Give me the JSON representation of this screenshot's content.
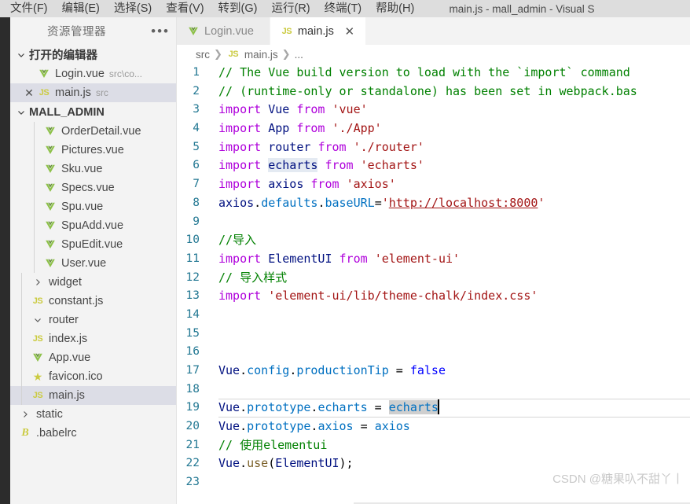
{
  "window": {
    "title": "main.js - mall_admin - Visual S",
    "menu": [
      {
        "label": "文件(F)",
        "name": "menu-file"
      },
      {
        "label": "编辑(E)",
        "name": "menu-edit"
      },
      {
        "label": "选择(S)",
        "name": "menu-selection"
      },
      {
        "label": "查看(V)",
        "name": "menu-view"
      },
      {
        "label": "转到(G)",
        "name": "menu-go"
      },
      {
        "label": "运行(R)",
        "name": "menu-run"
      },
      {
        "label": "终端(T)",
        "name": "menu-terminal"
      },
      {
        "label": "帮助(H)",
        "name": "menu-help"
      }
    ]
  },
  "sidebar": {
    "header": "资源管理器",
    "more_icon": "•••",
    "open_editors": {
      "title": "打开的编辑器",
      "items": [
        {
          "label": "Login.vue",
          "desc": "src\\co...",
          "icon": "vue",
          "close": false,
          "selected": false
        },
        {
          "label": "main.js",
          "desc": "src",
          "icon": "js",
          "close": true,
          "selected": true
        }
      ]
    },
    "project": {
      "title": "MALL_ADMIN",
      "items": [
        {
          "label": "OrderDetail.vue",
          "icon": "vue",
          "indent": 3,
          "kind": "file"
        },
        {
          "label": "Pictures.vue",
          "icon": "vue",
          "indent": 3,
          "kind": "file"
        },
        {
          "label": "Sku.vue",
          "icon": "vue",
          "indent": 3,
          "kind": "file"
        },
        {
          "label": "Specs.vue",
          "icon": "vue",
          "indent": 3,
          "kind": "file"
        },
        {
          "label": "Spu.vue",
          "icon": "vue",
          "indent": 3,
          "kind": "file"
        },
        {
          "label": "SpuAdd.vue",
          "icon": "vue",
          "indent": 3,
          "kind": "file"
        },
        {
          "label": "SpuEdit.vue",
          "icon": "vue",
          "indent": 3,
          "kind": "file"
        },
        {
          "label": "User.vue",
          "icon": "vue",
          "indent": 3,
          "kind": "file"
        },
        {
          "label": "widget",
          "icon": "chevron-right",
          "indent": 2,
          "kind": "folder-collapsed"
        },
        {
          "label": "constant.js",
          "icon": "js",
          "indent": 2,
          "kind": "file"
        },
        {
          "label": "router",
          "icon": "chevron-down",
          "indent": 2,
          "kind": "folder-expanded"
        },
        {
          "label": "index.js",
          "icon": "js",
          "indent": 2,
          "kind": "file"
        },
        {
          "label": "App.vue",
          "icon": "vue",
          "indent": 2,
          "kind": "file"
        },
        {
          "label": "favicon.ico",
          "icon": "star",
          "indent": 2,
          "kind": "file"
        },
        {
          "label": "main.js",
          "icon": "js",
          "indent": 2,
          "kind": "file",
          "selected": true
        },
        {
          "label": "static",
          "icon": "chevron-right",
          "indent": 1,
          "kind": "folder-collapsed"
        },
        {
          "label": ".babelrc",
          "icon": "babel",
          "indent": 1,
          "kind": "file"
        }
      ]
    }
  },
  "editor": {
    "tabs": [
      {
        "label": "Login.vue",
        "icon": "vue",
        "active": false,
        "closable": false
      },
      {
        "label": "main.js",
        "icon": "js",
        "active": true,
        "closable": true
      }
    ],
    "breadcrumb": [
      {
        "label": "src",
        "icon": null
      },
      {
        "label": "main.js",
        "icon": "js"
      },
      {
        "label": "...",
        "icon": null
      }
    ],
    "current_line": 19,
    "lines": [
      {
        "n": 1,
        "tokens": [
          {
            "t": "// The Vue build version to load with the `import` command",
            "c": "t-comment"
          }
        ]
      },
      {
        "n": 2,
        "tokens": [
          {
            "t": "// (runtime-only or standalone) has been set in webpack.bas",
            "c": "t-comment"
          }
        ]
      },
      {
        "n": 3,
        "tokens": [
          {
            "t": "import",
            "c": "t-keyword"
          },
          {
            "t": " ",
            "c": "t-plain"
          },
          {
            "t": "Vue",
            "c": "t-var"
          },
          {
            "t": " ",
            "c": "t-plain"
          },
          {
            "t": "from",
            "c": "t-keyword"
          },
          {
            "t": " ",
            "c": "t-plain"
          },
          {
            "t": "'vue'",
            "c": "t-string"
          }
        ]
      },
      {
        "n": 4,
        "tokens": [
          {
            "t": "import",
            "c": "t-keyword"
          },
          {
            "t": " ",
            "c": "t-plain"
          },
          {
            "t": "App",
            "c": "t-var"
          },
          {
            "t": " ",
            "c": "t-plain"
          },
          {
            "t": "from",
            "c": "t-keyword"
          },
          {
            "t": " ",
            "c": "t-plain"
          },
          {
            "t": "'./App'",
            "c": "t-string"
          }
        ]
      },
      {
        "n": 5,
        "tokens": [
          {
            "t": "import",
            "c": "t-keyword"
          },
          {
            "t": " ",
            "c": "t-plain"
          },
          {
            "t": "router",
            "c": "t-var"
          },
          {
            "t": " ",
            "c": "t-plain"
          },
          {
            "t": "from",
            "c": "t-keyword"
          },
          {
            "t": " ",
            "c": "t-plain"
          },
          {
            "t": "'./router'",
            "c": "t-string"
          }
        ]
      },
      {
        "n": 6,
        "tokens": [
          {
            "t": "import",
            "c": "t-keyword"
          },
          {
            "t": " ",
            "c": "t-plain"
          },
          {
            "t": "echarts",
            "c": "t-var",
            "hl": "match"
          },
          {
            "t": " ",
            "c": "t-plain"
          },
          {
            "t": "from",
            "c": "t-keyword"
          },
          {
            "t": " ",
            "c": "t-plain"
          },
          {
            "t": "'echarts'",
            "c": "t-string"
          }
        ]
      },
      {
        "n": 7,
        "tokens": [
          {
            "t": "import",
            "c": "t-keyword"
          },
          {
            "t": " ",
            "c": "t-plain"
          },
          {
            "t": "axios",
            "c": "t-var"
          },
          {
            "t": " ",
            "c": "t-plain"
          },
          {
            "t": "from",
            "c": "t-keyword"
          },
          {
            "t": " ",
            "c": "t-plain"
          },
          {
            "t": "'axios'",
            "c": "t-string"
          }
        ]
      },
      {
        "n": 8,
        "tokens": [
          {
            "t": "axios",
            "c": "t-var"
          },
          {
            "t": ".",
            "c": "t-punct"
          },
          {
            "t": "defaults",
            "c": "t-prop"
          },
          {
            "t": ".",
            "c": "t-punct"
          },
          {
            "t": "baseURL",
            "c": "t-prop"
          },
          {
            "t": "=",
            "c": "t-punct"
          },
          {
            "t": "'",
            "c": "t-string"
          },
          {
            "t": "http://localhost:8000",
            "c": "t-link"
          },
          {
            "t": "'",
            "c": "t-string"
          }
        ]
      },
      {
        "n": 9,
        "tokens": []
      },
      {
        "n": 10,
        "tokens": [
          {
            "t": "//导入",
            "c": "t-comment"
          }
        ]
      },
      {
        "n": 11,
        "tokens": [
          {
            "t": "import",
            "c": "t-keyword"
          },
          {
            "t": " ",
            "c": "t-plain"
          },
          {
            "t": "ElementUI",
            "c": "t-var"
          },
          {
            "t": " ",
            "c": "t-plain"
          },
          {
            "t": "from",
            "c": "t-keyword"
          },
          {
            "t": " ",
            "c": "t-plain"
          },
          {
            "t": "'element-ui'",
            "c": "t-string"
          }
        ]
      },
      {
        "n": 12,
        "tokens": [
          {
            "t": "// 导入样式",
            "c": "t-comment"
          }
        ]
      },
      {
        "n": 13,
        "tokens": [
          {
            "t": "import",
            "c": "t-keyword"
          },
          {
            "t": " ",
            "c": "t-plain"
          },
          {
            "t": "'element-ui/lib/theme-chalk/index.css'",
            "c": "t-string"
          }
        ]
      },
      {
        "n": 14,
        "tokens": []
      },
      {
        "n": 15,
        "tokens": []
      },
      {
        "n": 16,
        "tokens": []
      },
      {
        "n": 17,
        "tokens": [
          {
            "t": "Vue",
            "c": "t-var"
          },
          {
            "t": ".",
            "c": "t-punct"
          },
          {
            "t": "config",
            "c": "t-prop"
          },
          {
            "t": ".",
            "c": "t-punct"
          },
          {
            "t": "productionTip",
            "c": "t-prop"
          },
          {
            "t": " = ",
            "c": "t-punct"
          },
          {
            "t": "false",
            "c": "t-const"
          }
        ]
      },
      {
        "n": 18,
        "tokens": []
      },
      {
        "n": 19,
        "tokens": [
          {
            "t": "Vue",
            "c": "t-var"
          },
          {
            "t": ".",
            "c": "t-punct"
          },
          {
            "t": "prototype",
            "c": "t-prop"
          },
          {
            "t": ".",
            "c": "t-punct"
          },
          {
            "t": "echarts",
            "c": "t-prop"
          },
          {
            "t": " = ",
            "c": "t-punct"
          },
          {
            "t": "echarts",
            "c": "t-prop",
            "hl": "active"
          }
        ],
        "caret": true
      },
      {
        "n": 20,
        "tokens": [
          {
            "t": "Vue",
            "c": "t-var"
          },
          {
            "t": ".",
            "c": "t-punct"
          },
          {
            "t": "prototype",
            "c": "t-prop"
          },
          {
            "t": ".",
            "c": "t-punct"
          },
          {
            "t": "axios",
            "c": "t-prop"
          },
          {
            "t": " = ",
            "c": "t-punct"
          },
          {
            "t": "axios",
            "c": "t-prop"
          }
        ]
      },
      {
        "n": 21,
        "tokens": [
          {
            "t": "// 使用elementui",
            "c": "t-comment"
          }
        ]
      },
      {
        "n": 22,
        "tokens": [
          {
            "t": "Vue",
            "c": "t-var"
          },
          {
            "t": ".",
            "c": "t-punct"
          },
          {
            "t": "use",
            "c": "t-func"
          },
          {
            "t": "(",
            "c": "t-punct"
          },
          {
            "t": "ElementUI",
            "c": "t-var"
          },
          {
            "t": ");",
            "c": "t-punct"
          }
        ]
      },
      {
        "n": 23,
        "tokens": []
      }
    ]
  },
  "watermark": "CSDN @糖果叺不甜丫丨"
}
